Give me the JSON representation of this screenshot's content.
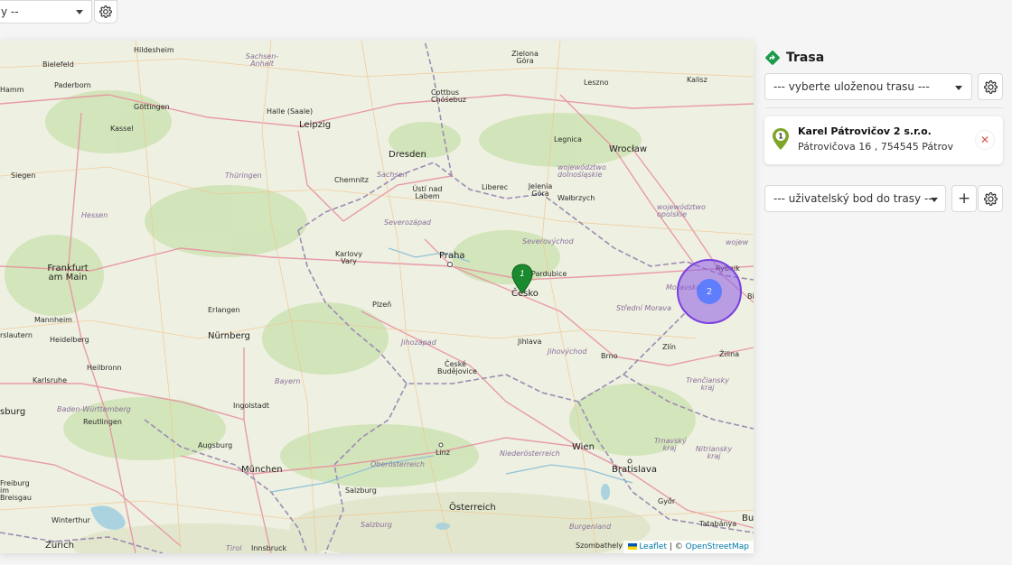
{
  "top": {
    "select_value": "y --"
  },
  "panel": {
    "title": "Trasa",
    "route_select": "--- vyberte uloženou trasu ---",
    "waypoint": {
      "number": "1",
      "name": "Karel Pátrovičov 2 s.r.o.",
      "address": "Pátrovičova 16 , 754545 Pátrov"
    },
    "user_point_select": "--- uživatelský bod do trasy ---",
    "add_label": "+"
  },
  "map": {
    "marker_number": "1",
    "cluster_count": "2",
    "attribution": {
      "leaflet": "Leaflet",
      "sep": " | © ",
      "osm": "OpenStreetMap"
    },
    "labels": {
      "bielefeld": "Bielefeld",
      "hildesheim": "Hildesheim",
      "sachsen_anhalt": "Sachsen-Anhalt",
      "paderborn": "Paderborn",
      "hamm": "Hamm",
      "gottingen": "Göttingen",
      "halle": "Halle (Saale)",
      "leipzig": "Leipzig",
      "cottbus": "Cottbus Chóśebuz",
      "zielona": "Zielona Góra",
      "leszno": "Leszno",
      "kalisz": "Kalisz",
      "kassel": "Kassel",
      "legnica": "Legnica",
      "wroclaw": "Wrocław",
      "siegen": "Siegen",
      "thuringen": "Thüringen",
      "chemnitz": "Chemnitz",
      "dresden": "Dresden",
      "sachsen": "Sachsen",
      "usti": "Ústí nad Labem",
      "liberec": "Liberec",
      "jelenia": "Jelenia Góra",
      "walbrzych": "Wałbrzych",
      "dolnoslaskie": "województwo dolnośląskie",
      "opolskie": "województwo opolskie",
      "hessen": "Hessen",
      "severozapad": "Severozápad",
      "karlovy": "Karlovy Vary",
      "praha": "Praha",
      "severovychod": "Severovýchod",
      "pardubice": "Pardubice",
      "cesko": "Česko",
      "frankfurt": "Frankfurt am Main",
      "plzen": "Plzeň",
      "erlangen": "Erlangen",
      "mannheim": "Mannheim",
      "heidelberg": "Heidelberg",
      "lautern": "rslautern",
      "nurnberg": "Nürnberg",
      "jihozapad": "Jihozápad",
      "jihlava": "Jihlava",
      "jihovychod": "Jihovýchod",
      "brno": "Brno",
      "stredni": "Střední Morava",
      "zlin": "Zlín",
      "zilina": "Žilina",
      "moravsko": "Moravsko",
      "rybnik": "Rybnik",
      "wojew": "wojew",
      "heilbronn": "Heilbronn",
      "karlsruhe": "Karlsruhe",
      "ceske": "České Budějovice",
      "bayern": "Bayern",
      "trenciansky": "Trenčiansky kraj",
      "ingolstadt": "Ingolstadt",
      "sburg": "sburg",
      "bw": "Baden-Württemberg",
      "reutlingen": "Reutlingen",
      "augsburg": "Augsburg",
      "linz": "Linz",
      "wien": "Wien",
      "niederosterreich": "Niederösterreich",
      "oberosterreich": "Oberösterreich",
      "trnavsky": "Trnavský kraj",
      "nitriansky": "Nitriansky kraj",
      "bratislava": "Bratislava",
      "munchen": "München",
      "salzburg": "Salzburg",
      "osterreich": "Österreich",
      "gyor": "Győr",
      "tatabanya": "Tatabánya",
      "bu": "Bu",
      "bi": "Bi",
      "freiburg": "Freiburg im Breisgau",
      "winterthur": "Winterthur",
      "zurich": "Zürich",
      "salzburg_region": "Salzburg",
      "burgenland": "Burgenland",
      "tirol": "Tirol",
      "innsbruck": "Innsbruck",
      "szombathely": "Szombathely"
    }
  }
}
